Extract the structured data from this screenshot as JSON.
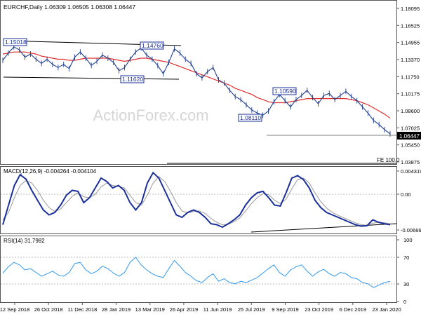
{
  "header": {
    "symbol_line": "EURCHF,Daily  1.06309 1.06505 1.06308 1.06447"
  },
  "watermark": "ActionForex.com",
  "colors": {
    "price": "#1f3f8f",
    "sma": "#e03030",
    "macd": "#1a2f99",
    "signal": "#999999",
    "rsi": "#3399ee",
    "level_line": "#000000",
    "frame": "#555555",
    "grid": "#bbbbbb",
    "label_box": "#1a2f99"
  },
  "chart_data": [
    {
      "type": "line",
      "name": "price",
      "ylim": [
        1.0375,
        1.1905
      ],
      "y_ticks": [
        "1.18095",
        "1.16525",
        "1.14955",
        "1.13370",
        "1.11750",
        "1.10175",
        "1.08600",
        "1.07025",
        "1.05450",
        "1.03875"
      ],
      "x_ticks": [
        "12 Sep 2018",
        "26 Oct 2018",
        "11 Dec 2018",
        "28 Jan 2019",
        "13 Mar 2019",
        "26 Apr 2019",
        "11 Jun 2019",
        "25 Jul 2019",
        "9 Sep 2019",
        "23 Oct 2019",
        "6 Dec 2019",
        "23 Jan 2020"
      ],
      "last_price": "1.06447",
      "fe_label": "FE 100.0",
      "annotations": [
        "1.15018",
        "1.14760",
        "1.11620",
        "1.10590",
        "1.08110"
      ],
      "series_close": [
        1.135,
        1.142,
        1.148,
        1.145,
        1.138,
        1.141,
        1.136,
        1.132,
        1.136,
        1.131,
        1.128,
        1.131,
        1.127,
        1.138,
        1.143,
        1.137,
        1.13,
        1.134,
        1.14,
        1.137,
        1.133,
        1.125,
        1.128,
        1.136,
        1.143,
        1.147,
        1.14,
        1.136,
        1.13,
        1.122,
        1.133,
        1.146,
        1.142,
        1.136,
        1.132,
        1.122,
        1.118,
        1.124,
        1.128,
        1.116,
        1.113,
        1.106,
        1.1,
        1.097,
        1.092,
        1.087,
        1.084,
        1.082,
        1.086,
        1.095,
        1.102,
        1.096,
        1.09,
        1.097,
        1.101,
        1.106,
        1.099,
        1.093,
        1.101,
        1.103,
        1.097,
        1.101,
        1.105,
        1.1,
        1.096,
        1.09,
        1.084,
        1.077,
        1.073,
        1.068,
        1.064
      ],
      "series_sma": [
        1.141,
        1.142,
        1.143,
        1.143,
        1.143,
        1.142,
        1.141,
        1.139,
        1.138,
        1.137,
        1.136,
        1.136,
        1.135,
        1.135,
        1.136,
        1.137,
        1.137,
        1.137,
        1.137,
        1.137,
        1.136,
        1.135,
        1.134,
        1.135,
        1.136,
        1.137,
        1.137,
        1.136,
        1.135,
        1.134,
        1.133,
        1.131,
        1.129,
        1.127,
        1.125,
        1.123,
        1.121,
        1.119,
        1.117,
        1.115,
        1.113,
        1.111,
        1.108,
        1.106,
        1.104,
        1.102,
        1.099,
        1.097,
        1.095,
        1.094,
        1.094,
        1.094,
        1.095,
        1.096,
        1.097,
        1.098,
        1.098,
        1.098,
        1.098,
        1.098,
        1.098,
        1.098,
        1.098,
        1.097,
        1.096,
        1.094,
        1.092,
        1.089,
        1.086,
        1.083,
        1.079
      ]
    },
    {
      "type": "line",
      "name": "MACD",
      "label": "MACD(12,26,9) -0.004264 -0.004104",
      "ylim": [
        -0.0075,
        0.0055
      ],
      "y_ticks": [
        "0.004319",
        "0.00",
        "-0.006663"
      ],
      "series_macd": [
        -0.006,
        -0.002,
        0.002,
        0.0042,
        0.0033,
        0.001,
        -0.001,
        -0.003,
        -0.004,
        -0.0035,
        -0.002,
        0.0,
        0.001,
        0.0008,
        -0.0015,
        -0.0005,
        0.0015,
        0.0035,
        0.0028,
        0.0015,
        0.002,
        0.001,
        -0.0015,
        -0.003,
        -0.0015,
        0.0025,
        0.0046,
        0.0035,
        0.001,
        -0.0015,
        -0.004,
        -0.0045,
        -0.0035,
        -0.003,
        -0.0035,
        -0.0045,
        -0.0058,
        -0.006,
        -0.0065,
        -0.0058,
        -0.005,
        -0.004,
        -0.002,
        -0.0005,
        0.0005,
        0.0008,
        -0.0005,
        -0.002,
        -0.0022,
        0.0005,
        0.0035,
        0.004,
        0.0032,
        0.0015,
        -0.001,
        -0.0025,
        -0.0035,
        -0.004,
        -0.0045,
        -0.005,
        -0.0055,
        -0.006,
        -0.0063,
        -0.0062,
        -0.005,
        -0.0055,
        -0.0058,
        -0.006
      ],
      "series_signal": [
        -0.005,
        -0.0035,
        -0.0005,
        0.002,
        0.003,
        0.0025,
        0.001,
        -0.001,
        -0.0025,
        -0.0033,
        -0.0028,
        -0.0015,
        -0.0002,
        0.0005,
        -0.0003,
        -0.0005,
        0.0002,
        0.0017,
        0.0025,
        0.002,
        0.0018,
        0.0015,
        0.0,
        -0.0015,
        -0.002,
        0.0,
        0.0025,
        0.0038,
        0.0028,
        0.0008,
        -0.0015,
        -0.0032,
        -0.0036,
        -0.0033,
        -0.0032,
        -0.0037,
        -0.0047,
        -0.0055,
        -0.006,
        -0.0059,
        -0.0054,
        -0.0046,
        -0.0032,
        -0.0017,
        -0.0005,
        0.0003,
        0.0001,
        -0.001,
        -0.0017,
        -0.0008,
        0.0013,
        0.0032,
        0.0035,
        0.0025,
        0.0005,
        -0.0013,
        -0.0026,
        -0.0035,
        -0.0041,
        -0.0046,
        -0.0051,
        -0.0056,
        -0.006,
        -0.0061,
        -0.0057,
        -0.0055,
        -0.0056,
        -0.0058
      ]
    },
    {
      "type": "line",
      "name": "RSI",
      "label": "RSI(14) 31.7982",
      "ylim": [
        0,
        100
      ],
      "y_ticks": [
        "100",
        "70",
        "30",
        "0"
      ],
      "series_rsi": [
        45,
        55,
        62,
        58,
        50,
        52,
        46,
        40,
        44,
        48,
        42,
        40,
        46,
        60,
        62,
        50,
        44,
        48,
        56,
        52,
        45,
        40,
        46,
        62,
        70,
        58,
        50,
        44,
        40,
        38,
        52,
        65,
        56,
        46,
        40,
        33,
        30,
        38,
        44,
        32,
        36,
        30,
        28,
        32,
        30,
        34,
        38,
        45,
        52,
        58,
        46,
        40,
        50,
        55,
        58,
        48,
        40,
        47,
        51,
        44,
        40,
        46,
        44,
        38,
        36,
        30,
        28,
        22,
        26,
        30,
        32
      ]
    }
  ]
}
